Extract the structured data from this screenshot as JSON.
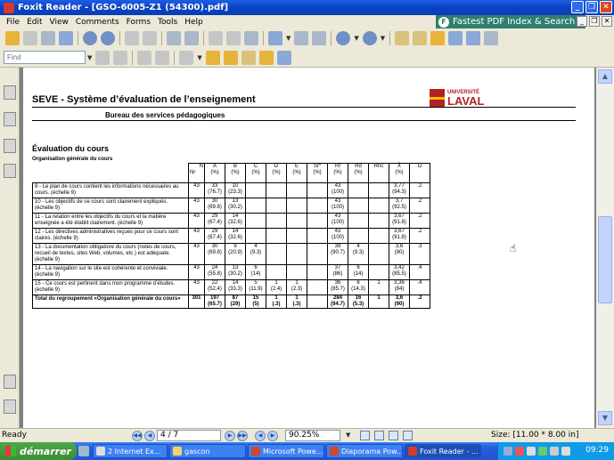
{
  "window": {
    "title": "Foxit Reader - [GSO-6005-Z1 (54300).pdf]"
  },
  "menu": [
    "File",
    "Edit",
    "View",
    "Comments",
    "Forms",
    "Tools",
    "Help"
  ],
  "banner": "Fastest PDF Index & Search",
  "find": {
    "placeholder": "Find"
  },
  "document": {
    "header_title": "SEVE - Système d’évaluation de l’enseignement",
    "header_subtitle": "Bureau des services pédagogiques",
    "logo": {
      "small": "UNIVERSITÉ",
      "big": "LAVAL"
    },
    "section_title": "Évaluation du cours",
    "subsection_title": "Organisation générale du cours",
    "table": {
      "header_n": "N",
      "header_nr": "Nr",
      "columns": [
        {
          "label": "A",
          "unit": "(%)"
        },
        {
          "label": "B",
          "unit": "(%)"
        },
        {
          "label": "C",
          "unit": "(%)"
        },
        {
          "label": "D",
          "unit": "(%)"
        },
        {
          "label": "E",
          "unit": "(%)"
        },
        {
          "label": "Sr*",
          "unit": "(%)"
        },
        {
          "label": "Rf",
          "unit": "(%)"
        },
        {
          "label": "Rd",
          "unit": "(%)"
        },
        {
          "label": "Rnc",
          "unit": ""
        },
        {
          "label": "X̄",
          "unit": "(%)"
        },
        {
          "label": "D",
          "unit": ""
        }
      ],
      "rows": [
        {
          "label": "9 - Le plan de cours contient les informations nécessaires au cours. (échelle 9)",
          "n": "43",
          "cells": [
            [
              "33",
              "(76.7)"
            ],
            [
              "10",
              "(23.3)"
            ],
            [
              "",
              ""
            ],
            [
              "",
              ""
            ],
            [
              "",
              ""
            ],
            [
              "",
              ""
            ],
            [
              "43",
              "(100)"
            ],
            [
              "",
              ""
            ],
            [
              "",
              ""
            ],
            [
              "3,77",
              "(94.3)"
            ],
            [
              ".2",
              ""
            ]
          ]
        },
        {
          "label": "10 - Les objectifs de ce cours sont clairement expliqués. (échelle 9)",
          "n": "43",
          "cells": [
            [
              "30",
              "(69.8)"
            ],
            [
              "13",
              "(30.2)"
            ],
            [
              "",
              ""
            ],
            [
              "",
              ""
            ],
            [
              "",
              ""
            ],
            [
              "",
              ""
            ],
            [
              "43",
              "(100)"
            ],
            [
              "",
              ""
            ],
            [
              "",
              ""
            ],
            [
              "3,7",
              "(92.5)"
            ],
            [
              ".2",
              ""
            ]
          ]
        },
        {
          "label": "11 - La relation entre les objectifs du cours et la matière enseignée a été établit clairement. (échelle 9)",
          "n": "43",
          "cells": [
            [
              "29",
              "(67.4)"
            ],
            [
              "14",
              "(32.6)"
            ],
            [
              "",
              ""
            ],
            [
              "",
              ""
            ],
            [
              "",
              ""
            ],
            [
              "",
              ""
            ],
            [
              "43",
              "(100)"
            ],
            [
              "",
              ""
            ],
            [
              "",
              ""
            ],
            [
              "3,67",
              "(91.8)"
            ],
            [
              ".2",
              ""
            ]
          ]
        },
        {
          "label": "12 - Les directives administratives reçues pour ce cours sont claires. (échelle 9)",
          "n": "43",
          "cells": [
            [
              "29",
              "(67.4)"
            ],
            [
              "14",
              "(32.6)"
            ],
            [
              "",
              ""
            ],
            [
              "",
              ""
            ],
            [
              "",
              ""
            ],
            [
              "",
              ""
            ],
            [
              "43",
              "(100)"
            ],
            [
              "",
              ""
            ],
            [
              "",
              ""
            ],
            [
              "3,67",
              "(91.8)"
            ],
            [
              ".2",
              ""
            ]
          ]
        },
        {
          "label": "13 - La documentation obligatoire du cours (notes de cours, recueil de textes, sites Web, volumes, etc.) est adéquate. (échelle 9)",
          "n": "43",
          "cells": [
            [
              "30",
              "(69.8)"
            ],
            [
              "9",
              "(20.9)"
            ],
            [
              "4",
              "(9.3)"
            ],
            [
              "",
              ""
            ],
            [
              "",
              ""
            ],
            [
              "",
              ""
            ],
            [
              "39",
              "(90.7)"
            ],
            [
              "4",
              "(9.3)"
            ],
            [
              "",
              ""
            ],
            [
              "3,6",
              "(90)"
            ],
            [
              ".3",
              ""
            ]
          ]
        },
        {
          "label": "14 - La navigation sur le site est cohérente et conviviale. (échelle 9)",
          "n": "43",
          "cells": [
            [
              "24",
              "(55.8)"
            ],
            [
              "13",
              "(30.2)"
            ],
            [
              "6",
              "(14)"
            ],
            [
              "",
              ""
            ],
            [
              "",
              ""
            ],
            [
              "",
              ""
            ],
            [
              "37",
              "(86)"
            ],
            [
              "6",
              "(14)"
            ],
            [
              "",
              ""
            ],
            [
              "3,42",
              "(85.5)"
            ],
            [
              ".4",
              ""
            ]
          ]
        },
        {
          "label": "15 - Ce cours est pertinent dans mon programme d’études. (échelle 9)",
          "n": "43",
          "cells": [
            [
              "22",
              "(52.4)"
            ],
            [
              "14",
              "(33.3)"
            ],
            [
              "5",
              "(11.9)"
            ],
            [
              "1",
              "(2.4)"
            ],
            [
              "1",
              "(2.3)"
            ],
            [
              "",
              ""
            ],
            [
              "36",
              "(85.7)"
            ],
            [
              "6",
              "(14.3)"
            ],
            [
              "1",
              ""
            ],
            [
              "3,36",
              "(84)"
            ],
            [
              ".4",
              ""
            ]
          ]
        }
      ],
      "total": {
        "label": "Total du regroupement «Organisation générale du cours»",
        "n": "301",
        "cells": [
          [
            "197",
            "(65.7)"
          ],
          [
            "87",
            "(29)"
          ],
          [
            "15",
            "(5)"
          ],
          [
            "1",
            "(.3)"
          ],
          [
            "1",
            "(.3)"
          ],
          [
            "",
            ""
          ],
          [
            "284",
            "(94.7)"
          ],
          [
            "16",
            "(5.3)"
          ],
          [
            "1",
            ""
          ],
          [
            "3,6",
            "(90)"
          ],
          [
            ".3",
            ""
          ]
        ]
      }
    }
  },
  "status": {
    "ready": "Ready",
    "page": "4 / 7",
    "zoom": "90.25%",
    "size": "Size: [11.00 * 8.00 in]"
  },
  "taskbar": {
    "start": "démarrer",
    "tasks": [
      {
        "label": "2 Internet Ex...",
        "active": false
      },
      {
        "label": "gascon",
        "active": false
      },
      {
        "label": "Microsoft Powe...",
        "active": false
      },
      {
        "label": "Diaporama Pow...",
        "active": false
      },
      {
        "label": "Foxit Reader - ...",
        "active": true
      }
    ],
    "clock": "09:29"
  }
}
